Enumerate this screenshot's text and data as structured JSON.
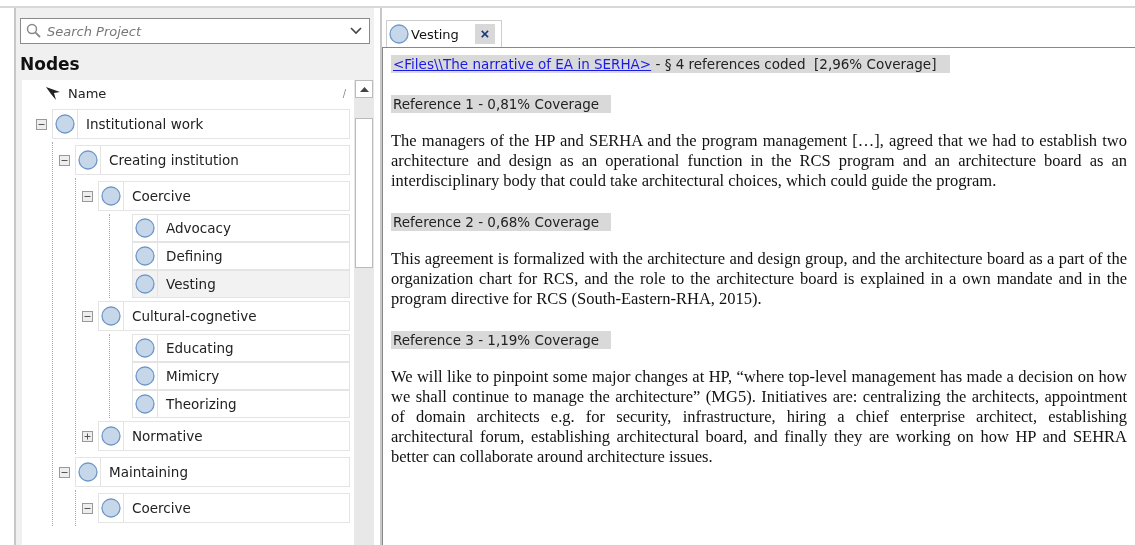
{
  "search": {
    "placeholder": "Search Project"
  },
  "nodes_panel": {
    "title": "Nodes",
    "column_header": "Name",
    "sort_mark": "/"
  },
  "tree": [
    {
      "label": "Institutional work",
      "expanded": true,
      "selected": false,
      "children": [
        {
          "label": "Creating institution",
          "expanded": true,
          "selected": false,
          "children": [
            {
              "label": "Coercive",
              "expanded": true,
              "selected": false,
              "children": [
                {
                  "label": "Advocacy",
                  "selected": false
                },
                {
                  "label": "Defining",
                  "selected": false
                },
                {
                  "label": "Vesting",
                  "selected": true
                }
              ]
            },
            {
              "label": "Cultural-cognetive",
              "expanded": true,
              "selected": false,
              "children": [
                {
                  "label": "Educating",
                  "selected": false
                },
                {
                  "label": "Mimicry",
                  "selected": false
                },
                {
                  "label": "Theorizing",
                  "selected": false
                }
              ]
            },
            {
              "label": "Normative",
              "expanded": false,
              "selected": false
            }
          ]
        },
        {
          "label": "Maintaining",
          "expanded": true,
          "selected": false,
          "children": [
            {
              "label": "Coercive",
              "expanded": true,
              "selected": false
            }
          ]
        }
      ]
    }
  ],
  "tab": {
    "label": "Vesting",
    "close": "×"
  },
  "document": {
    "link": "<Files\\\\The narrative of EA in SERHA>",
    "summary": " - § 4 references coded  [2,96% Coverage]",
    "references": [
      {
        "title": "Reference 1 - 0,81% Coverage",
        "text": "The managers of the HP and SERHA and the program management […], agreed that we had to establish two architecture and design as an operational function in the RCS program and an architecture board as an interdisciplinary body that could take architectural choices, which could guide the program."
      },
      {
        "title": "Reference 2 - 0,68% Coverage",
        "text": "This agreement is formalized with the architecture and design group, and the architecture board as a part of the organization chart for RCS, and the role to the architecture board is explained in a own mandate and in the program directive for RCS (South-Eastern-RHA, 2015)."
      },
      {
        "title": "Reference 3 - 1,19% Coverage",
        "text": "We will like to pinpoint some major changes at HP, “where top-level management has made a decision on how we shall continue to manage the architecture” (MG5). Initiatives are: centralizing the architects, appointment of domain architects e.g. for security, infrastructure, hiring a chief enterprise architect, establishing architectural forum, establishing architectural board, and finally they are working on how HP and SEHRA better can collaborate around architecture issues."
      }
    ]
  }
}
